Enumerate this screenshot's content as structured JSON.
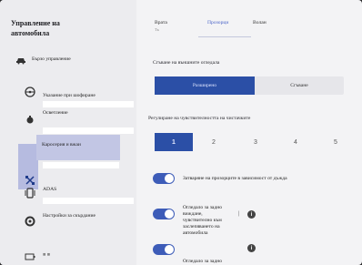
{
  "sidebar": {
    "title_line1": "Управление на",
    "title_line2": "автомобила",
    "items": [
      {
        "label": "Бързо управление",
        "icon": "car-icon"
      },
      {
        "label": "Указание при шофиране",
        "icon": "steering-wheel-icon"
      },
      {
        "label": "Осветление",
        "icon": "light-bulb-icon"
      },
      {
        "label": "Каросерия и вжаи",
        "icon": "car-body-icon",
        "active": true
      },
      {
        "label": "ADAS",
        "icon": "adas-icon"
      },
      {
        "label": "Настройки за скърдание",
        "icon": "tire-icon"
      },
      {
        "label": "",
        "icon": "battery-icon"
      }
    ]
  },
  "tabs": [
    {
      "label": "Врата"
    },
    {
      "label": "Прозорци",
      "active": true
    },
    {
      "label": "Волан"
    }
  ],
  "tab_misc": "Тк",
  "mirrors": {
    "label": "Сгъване на външните огледала",
    "options": [
      "Разширено",
      "Сгъване"
    ],
    "selected": "Разширено"
  },
  "wipers": {
    "label": "Регулиране на чувствителността на чистачките",
    "levels": [
      "1",
      "2",
      "3",
      "4",
      "5"
    ],
    "selected": "1"
  },
  "toggles": [
    {
      "text": "Затваряне на прозорците в зависимост от дъжда",
      "on": true
    },
    {
      "text_lines": [
        "Огледало за задно",
        "виждане,",
        "чувствително към",
        "заслепяването на",
        "автомобила"
      ],
      "on": true,
      "info": "i"
    },
    {
      "text": "Огледало за задно",
      "on": true,
      "info": "i"
    }
  ],
  "marker": "|"
}
